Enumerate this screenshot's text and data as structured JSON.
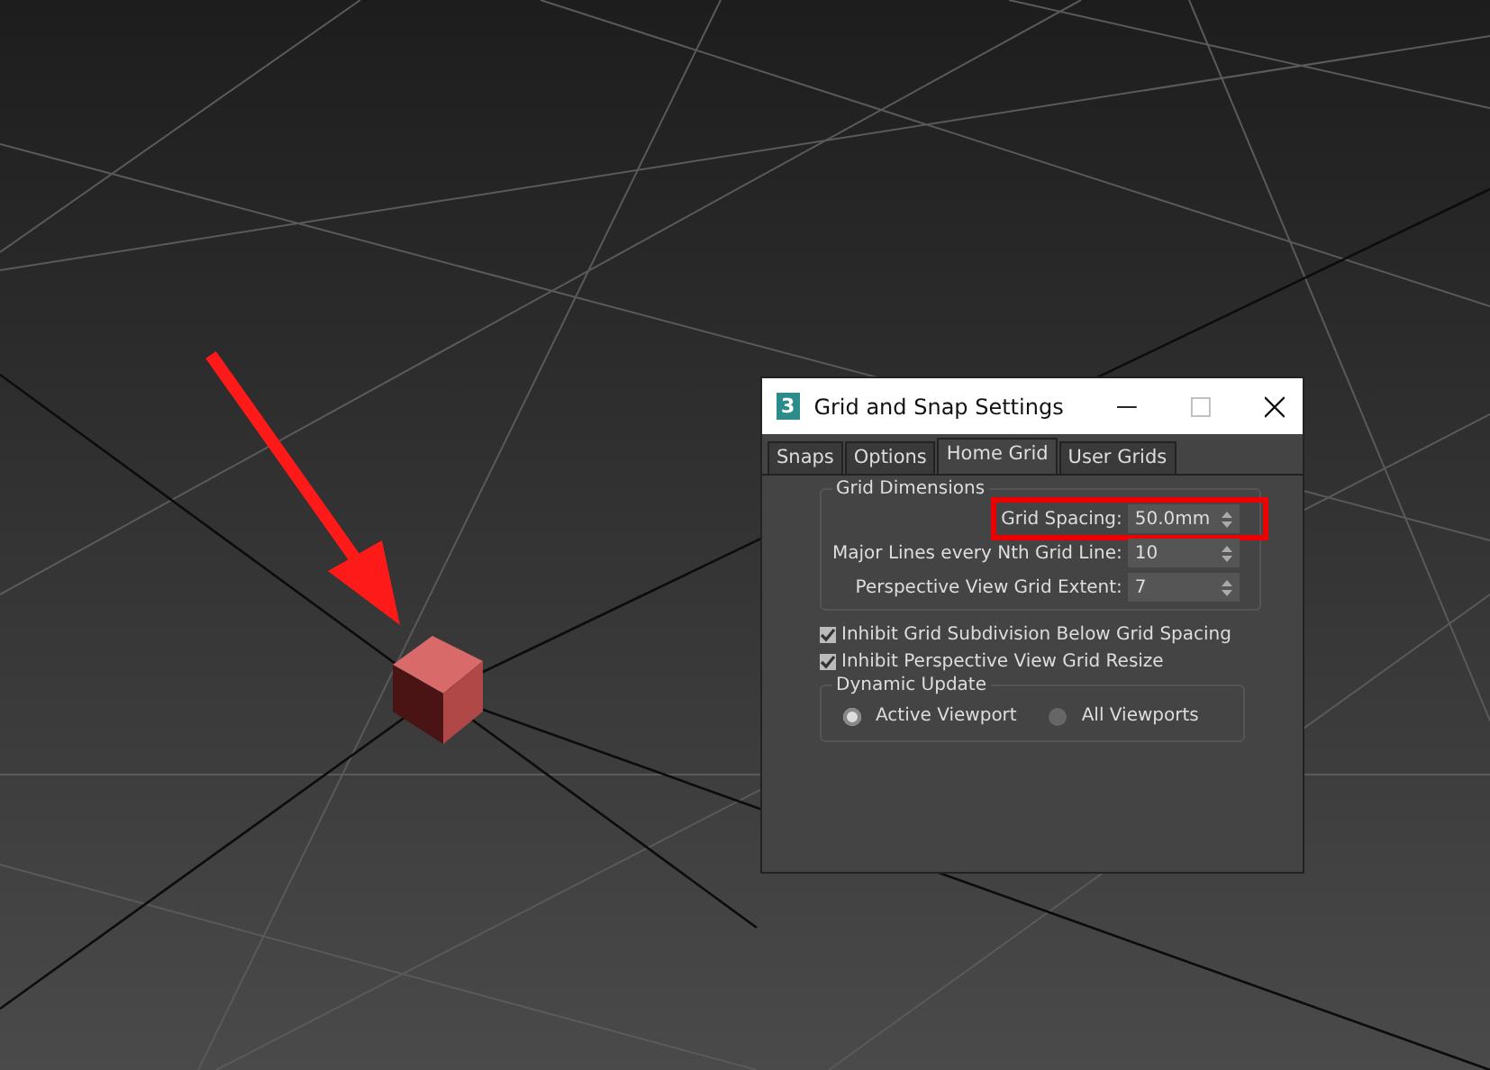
{
  "window": {
    "icon": "3",
    "title": "Grid and Snap Settings"
  },
  "tabs": [
    {
      "label": "Snaps",
      "selected": false
    },
    {
      "label": "Options",
      "selected": false
    },
    {
      "label": "Home Grid",
      "selected": true
    },
    {
      "label": "User Grids",
      "selected": false
    }
  ],
  "grid_dimensions": {
    "title": "Grid Dimensions",
    "fields": [
      {
        "label": "Grid Spacing:",
        "value": "50.0mm",
        "highlighted": true
      },
      {
        "label": "Major Lines every Nth Grid Line:",
        "value": "10",
        "highlighted": false
      },
      {
        "label": "Perspective View Grid Extent:",
        "value": "7",
        "highlighted": false
      }
    ]
  },
  "checkboxes": [
    {
      "label": "Inhibit Grid Subdivision Below Grid Spacing",
      "checked": true
    },
    {
      "label": "Inhibit Perspective View Grid Resize",
      "checked": true
    }
  ],
  "dynamic_update": {
    "title": "Dynamic Update",
    "options": [
      {
        "label": "Active Viewport",
        "selected": true
      },
      {
        "label": "All Viewports",
        "selected": false
      }
    ]
  }
}
